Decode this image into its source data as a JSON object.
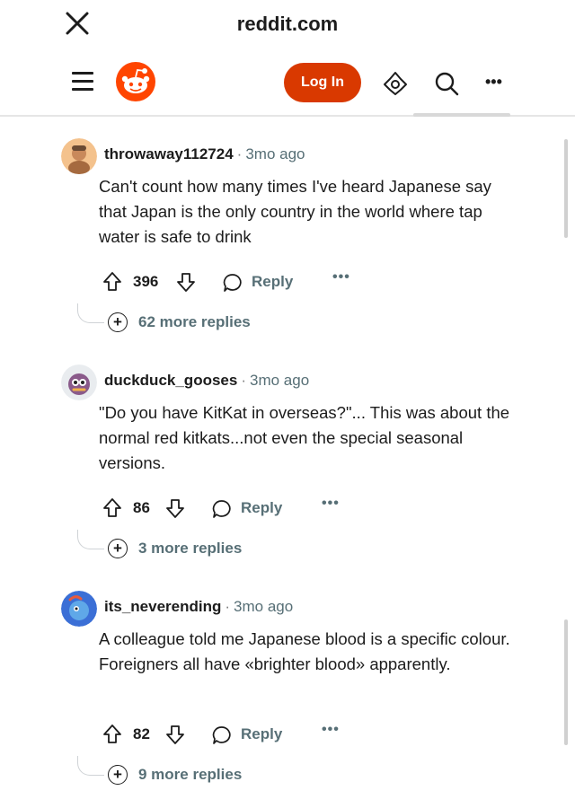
{
  "browser": {
    "url": "reddit.com"
  },
  "header": {
    "login_label": "Log In",
    "more_label": "•••"
  },
  "comments": [
    {
      "username": "throwaway112724",
      "separator": "·",
      "time": "3mo ago",
      "text": "Can't count how many times I've heard Japanese say that Japan is the only country in the world where tap water is safe to drink",
      "score": "396",
      "reply_label": "Reply",
      "more_label": "•••",
      "more_replies": "62 more replies"
    },
    {
      "username": "duckduck_gooses",
      "separator": "·",
      "time": "3mo ago",
      "text": "\"Do you have KitKat in overseas?\"... This was about the normal red kitkats...not even the special seasonal versions.",
      "score": "86",
      "reply_label": "Reply",
      "more_label": "•••",
      "more_replies": "3 more replies"
    },
    {
      "username": "its_neverending",
      "separator": "·",
      "time": "3mo ago",
      "text": "A colleague told me Japanese blood is a specific colour. Foreigners all have «brighter blood» apparently.",
      "score": "82",
      "reply_label": "Reply",
      "more_label": "•••",
      "more_replies": "9 more replies"
    }
  ],
  "colors": {
    "brand": "#ff4500",
    "login_bg": "#d93900",
    "meta_text": "#576f76"
  },
  "icons": [
    "close-icon",
    "menu-icon",
    "reddit-logo-icon",
    "avatar-icon",
    "search-icon",
    "more-icon",
    "upvote-icon",
    "downvote-icon",
    "comment-bubble-icon",
    "plus-circle-icon"
  ]
}
